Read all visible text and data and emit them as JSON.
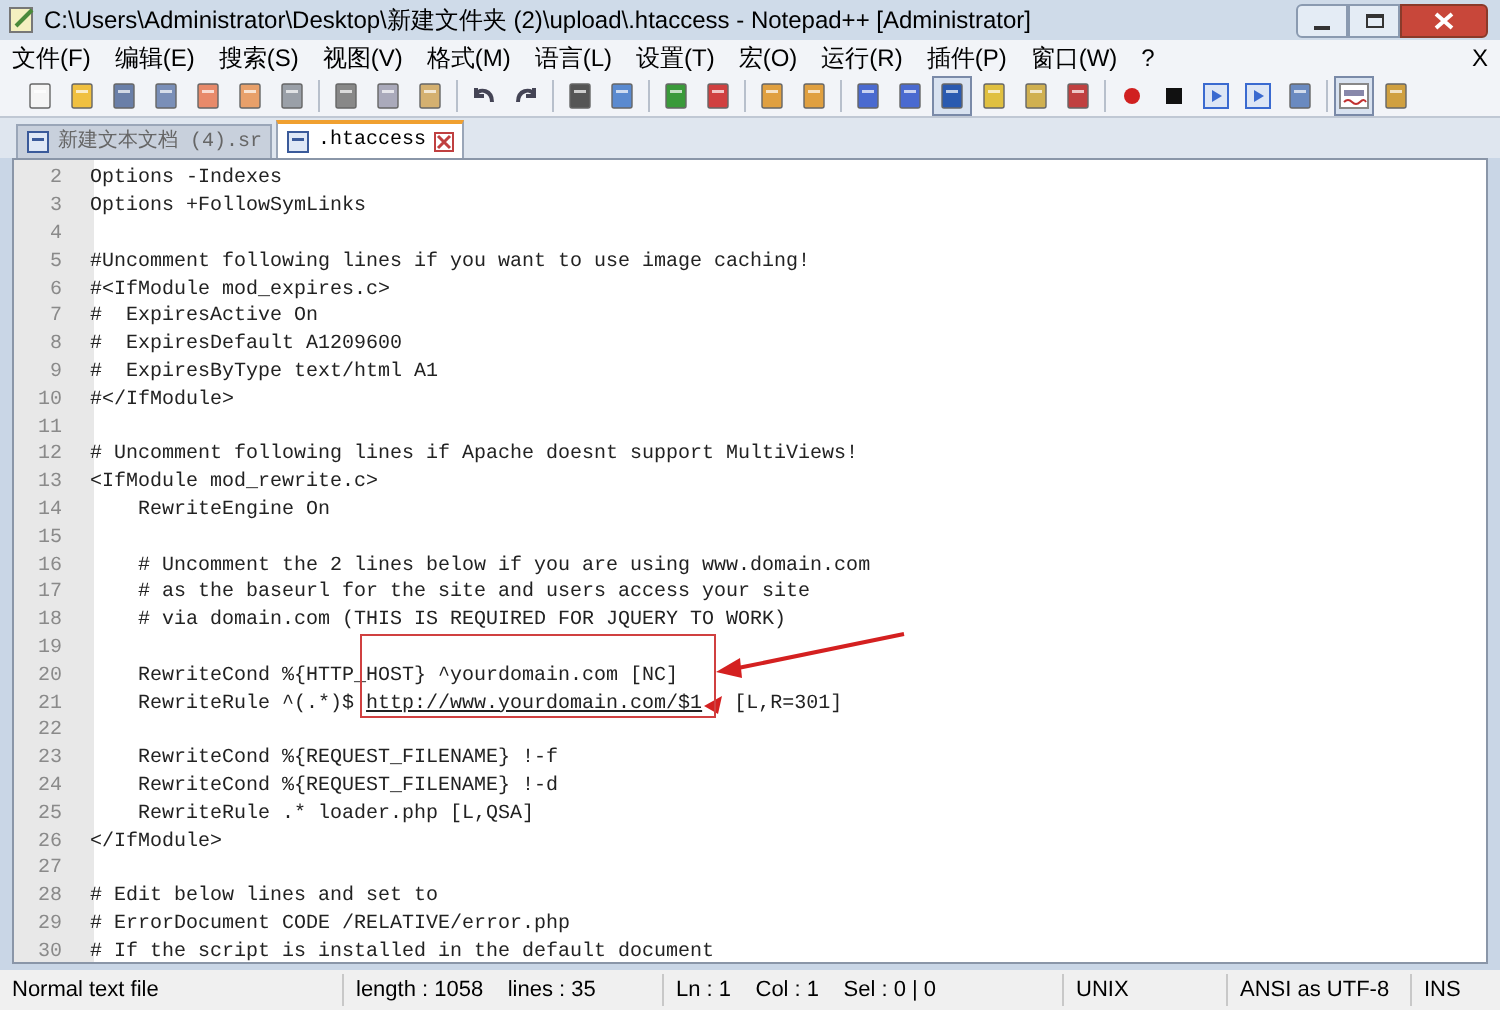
{
  "window": {
    "title": "C:\\Users\\Administrator\\Desktop\\新建文件夹 (2)\\upload\\.htaccess - Notepad++ [Administrator]"
  },
  "menu": {
    "items": [
      "文件(F)",
      "编辑(E)",
      "搜索(S)",
      "视图(V)",
      "格式(M)",
      "语言(L)",
      "设置(T)",
      "宏(O)",
      "运行(R)",
      "插件(P)",
      "窗口(W)",
      "?"
    ],
    "close": "X"
  },
  "tabs": [
    {
      "label": "新建文本文档 (4).sr",
      "selected": false
    },
    {
      "label": ".htaccess",
      "selected": true
    }
  ],
  "editor": {
    "lines": [
      {
        "number": "2",
        "text": "Options -Indexes"
      },
      {
        "number": "3",
        "text": "Options +FollowSymLinks"
      },
      {
        "number": "4"
      },
      {
        "number": "5",
        "text": "#Uncomment following lines if you want to use image caching!"
      },
      {
        "number": "6",
        "text": "#<IfModule mod_expires.c>"
      },
      {
        "number": "7",
        "text": "#  ExpiresActive On"
      },
      {
        "number": "8",
        "text": "#  ExpiresDefault A1209600"
      },
      {
        "number": "9",
        "text": "#  ExpiresByType text/html A1"
      },
      {
        "number": "10",
        "text": "#</IfModule>"
      },
      {
        "number": "11"
      },
      {
        "number": "12",
        "text": "# Uncomment following lines if Apache doesnt support MultiViews!"
      },
      {
        "number": "13",
        "text": "<IfModule mod_rewrite.c>"
      },
      {
        "number": "14",
        "text": "    RewriteEngine On"
      },
      {
        "number": "15"
      },
      {
        "number": "16",
        "text": "    # Uncomment the 2 lines below if you are using www.domain.com"
      },
      {
        "number": "17",
        "text": "    # as the baseurl for the site and users access your site"
      },
      {
        "number": "18",
        "text": "    # via domain.com (THIS IS REQUIRED FOR JQUERY TO WORK)"
      },
      {
        "number": "19"
      },
      {
        "number": "20",
        "text": "    RewriteCond %{HTTP_HOST} ^yourdomain.com [NC]"
      },
      {
        "number": "21",
        "text": "    RewriteRule ^(.*)$ ",
        "link": "http://www.yourdomain.com/$1",
        "after": " [L,R=301]"
      },
      {
        "number": "22"
      },
      {
        "number": "23",
        "text": "    RewriteCond %{REQUEST_FILENAME} !-f"
      },
      {
        "number": "24",
        "text": "    RewriteCond %{REQUEST_FILENAME} !-d"
      },
      {
        "number": "25",
        "text": "    RewriteRule .* loader.php [L,QSA]"
      },
      {
        "number": "26",
        "text": "</IfModule>"
      },
      {
        "number": "27"
      },
      {
        "number": "28",
        "text": "# Edit below lines and set to"
      },
      {
        "number": "29",
        "text": "# ErrorDocument CODE /RELATIVE/error.php"
      },
      {
        "number": "30",
        "text": "# If the script is installed in the default document"
      }
    ]
  },
  "status_bar": [
    "Normal text file",
    "length : 1058    lines : 35",
    "Ln : 1    Col : 1    Sel : 0 | 0",
    "UNIX",
    "ANSI as UTF-8",
    "INS"
  ]
}
